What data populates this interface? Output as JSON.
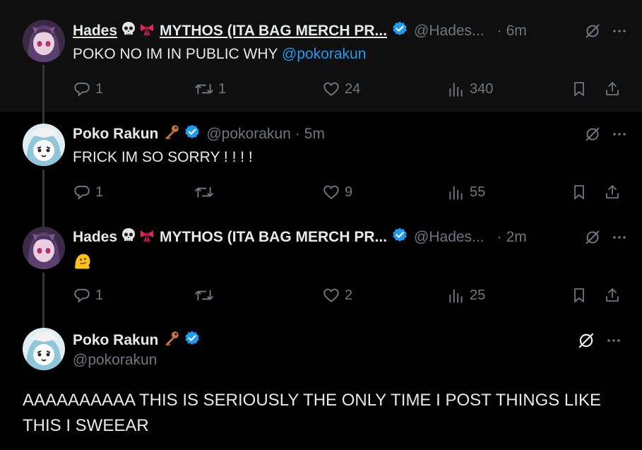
{
  "tweets": [
    {
      "name": "Hades",
      "name_suffix": "MYTHOS (ITA BAG MERCH PR...",
      "handle": "@Hades...",
      "dot": "·",
      "time": "6m",
      "text_prefix": "POKO NO IM IN PUBLIC WHY ",
      "mention": "@pokorakun",
      "replies": "1",
      "reposts": "1",
      "likes": "24",
      "views": "340"
    },
    {
      "name": "Poko Rakun",
      "handle": "@pokorakun",
      "dot": "·",
      "time": "5m",
      "text": "FRICK IM SO SORRY ! ! ! !",
      "replies": "1",
      "reposts": "",
      "likes": "9",
      "views": "55"
    },
    {
      "name": "Hades",
      "name_suffix": "MYTHOS (ITA BAG MERCH PR...",
      "handle": "@Hades...",
      "dot": "·",
      "time": "2m",
      "text": "🫠",
      "replies": "1",
      "reposts": "",
      "likes": "2",
      "views": "25"
    }
  ],
  "main": {
    "name": "Poko Rakun",
    "handle": "@pokorakun",
    "text": "AAAAAAAAAA THIS IS SERIOUSLY THE ONLY TIME I POST THINGS LIKE THIS I SWEEAR"
  },
  "colors": {
    "accent": "#1d9bf0",
    "muted": "#71767b",
    "text": "#e7e9ea",
    "background": "#000000"
  },
  "icons": [
    "skull-emoji",
    "ribbon-emoji",
    "key-emoji",
    "verified-badge-icon",
    "grok-icon",
    "more-icon",
    "reply-icon",
    "repost-icon",
    "like-icon",
    "views-icon",
    "bookmark-icon",
    "share-icon"
  ]
}
